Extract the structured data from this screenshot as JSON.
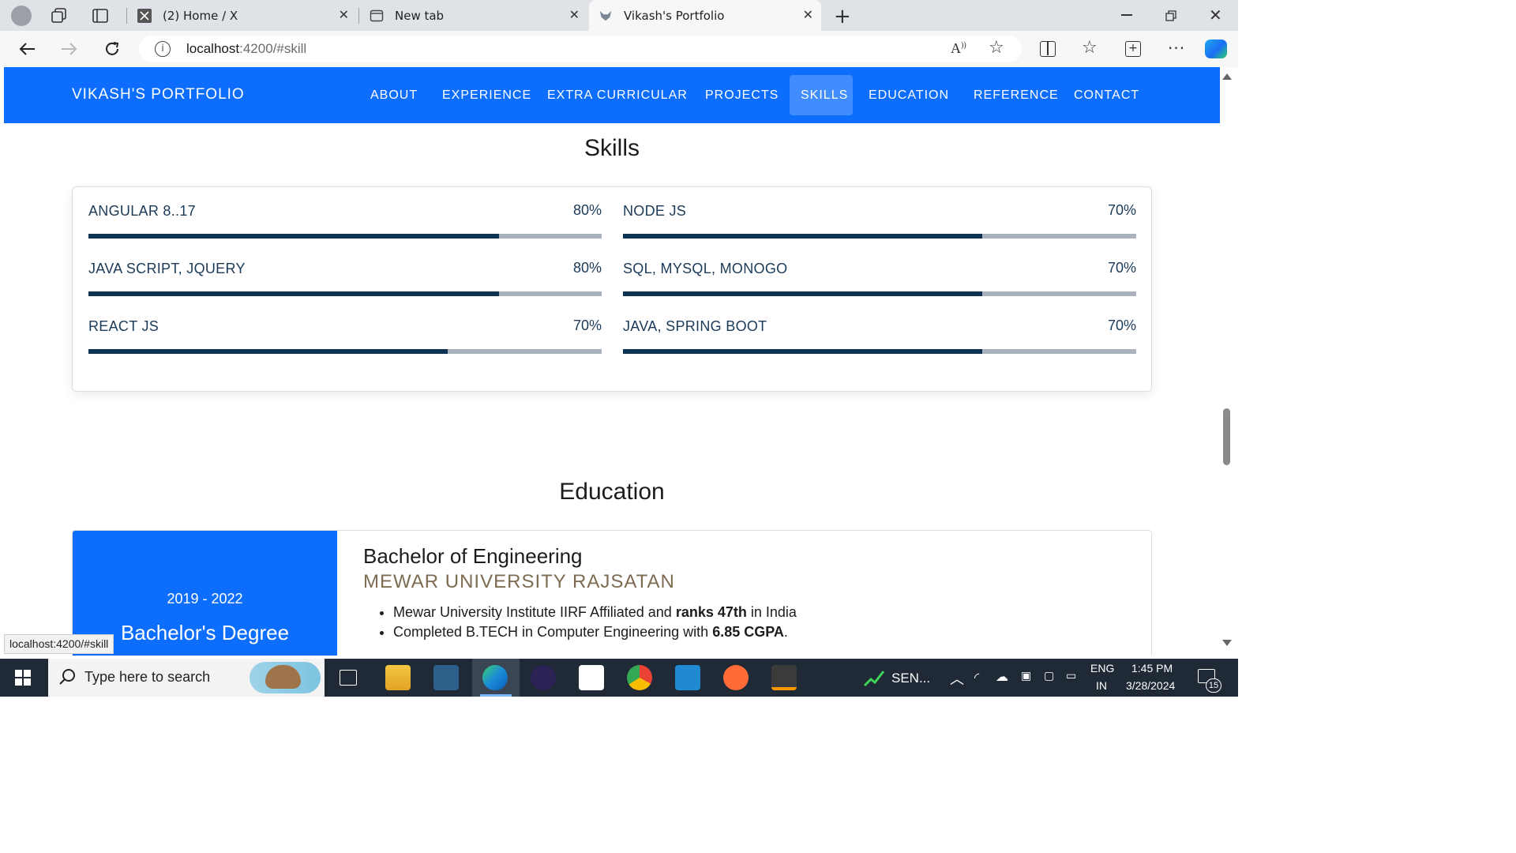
{
  "browser": {
    "tabs": [
      {
        "title": "(2) Home / X",
        "icon": "x-logo-icon"
      },
      {
        "title": "New tab",
        "icon": "new-tab-icon"
      },
      {
        "title": "Vikash's Portfolio",
        "icon": "wolf-favicon-icon",
        "active": true
      }
    ],
    "url_host": "localhost",
    "url_rest": ":4200/#skill",
    "status_url": "localhost:4200/#skill"
  },
  "site": {
    "brand": "VIKASH'S PORTFOLIO",
    "nav": [
      "ABOUT",
      "EXPERIENCE",
      "EXTRA CURRICULAR",
      "PROJECTS",
      "SKILLS",
      "EDUCATION",
      "REFERENCE",
      "CONTACT"
    ],
    "active_nav": "SKILLS",
    "accent": "#0d6efd"
  },
  "skills": {
    "title": "Skills",
    "items": [
      {
        "name": "ANGULAR 8..17",
        "percent_label": "80%",
        "level": 0.8
      },
      {
        "name": "NODE JS",
        "percent_label": "70%",
        "level": 0.7
      },
      {
        "name": "JAVA SCRIPT, JQUERY",
        "percent_label": "80%",
        "level": 0.8
      },
      {
        "name": "SQL, MYSQL, MONOGO",
        "percent_label": "70%",
        "level": 0.7
      },
      {
        "name": "REACT JS",
        "percent_label": "70%",
        "level": 0.7
      },
      {
        "name": "JAVA, SPRING BOOT",
        "percent_label": "70%",
        "level": 0.7
      }
    ]
  },
  "education": {
    "title": "Education",
    "years": "2019 - 2022",
    "degree_short": "Bachelor's Degree",
    "degree": "Bachelor of Engineering",
    "university": "MEWAR UNIVERSITY RAJSATAN",
    "bullets": [
      {
        "pre": "Mewar University Institute IIRF Affiliated and ",
        "bold": "ranks 47th",
        "post": " in India"
      },
      {
        "pre": "Completed B.TECH in Computer Engineering with ",
        "bold": "6.85 CGPA",
        "post": "."
      }
    ]
  },
  "taskbar": {
    "search_placeholder": "Type here to search",
    "sensex_label": "SEN...",
    "lang_top": "ENG",
    "lang_bottom": "IN",
    "time": "1:45 PM",
    "date": "3/28/2024",
    "notifications": "15"
  }
}
